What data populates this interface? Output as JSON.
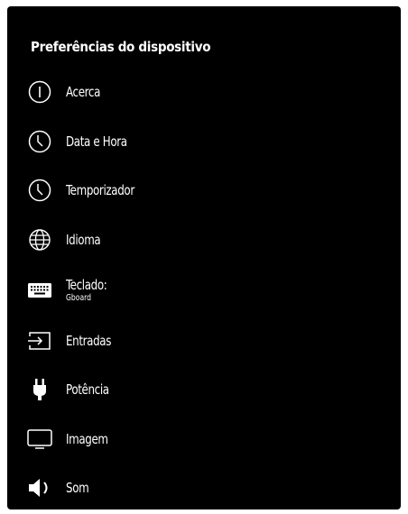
{
  "panel": {
    "title": "Preferências do dispositivo"
  },
  "menu": {
    "items": [
      {
        "label": "Acerca",
        "icon": "info-icon"
      },
      {
        "label": "Data e Hora",
        "icon": "clock-icon"
      },
      {
        "label": "Temporizador",
        "icon": "timer-icon"
      },
      {
        "label": "Idioma",
        "icon": "globe-icon"
      },
      {
        "label": "Teclado:",
        "sublabel": "Gboard",
        "icon": "keyboard-icon"
      },
      {
        "label": "Entradas",
        "icon": "input-icon"
      },
      {
        "label": "Potência",
        "icon": "power-plug-icon"
      },
      {
        "label": "Imagem",
        "icon": "monitor-icon"
      },
      {
        "label": "Som",
        "icon": "speaker-icon"
      }
    ]
  },
  "colors": {
    "background": "#000000",
    "text": "#ffffff",
    "page": "#ffffff"
  }
}
